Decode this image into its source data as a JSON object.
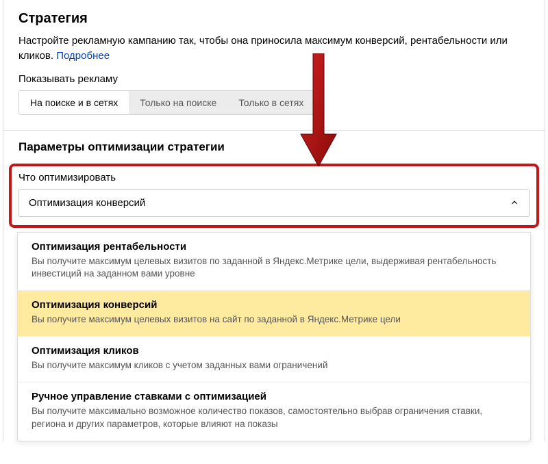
{
  "strategy": {
    "title": "Стратегия",
    "description": "Настройте рекламную кампанию так, чтобы она приносила максимум конверсий, рентабельности или кликов. ",
    "more_link": "Подробнее"
  },
  "show_ads": {
    "label": "Показывать рекламу",
    "options": [
      "На поиске и в сетях",
      "Только на поиске",
      "Только в сетях"
    ],
    "selected_index": 0
  },
  "params": {
    "heading": "Параметры оптимизации стратегии",
    "optimize_label": "Что оптимизировать",
    "selected_value": "Оптимизация конверсий"
  },
  "options": [
    {
      "title": "Оптимизация рентабельности",
      "desc": "Вы получите максимум целевых визитов по заданной в Яндекс.Метрике цели, выдерживая рентабельность инвестиций на заданном вами уровне",
      "selected": false
    },
    {
      "title": "Оптимизация конверсий",
      "desc": "Вы получите максимум целевых визитов на сайт по заданной в Яндекс.Метрике цели",
      "selected": true
    },
    {
      "title": "Оптимизация кликов",
      "desc": "Вы получите максимум кликов с учетом заданных вами ограничений",
      "selected": false
    },
    {
      "title": "Ручное управление ставками с оптимизацией",
      "desc": "Вы получите максимально возможное количество показов, самостоятельно выбрав ограничения ставки, региона и других параметров, которые влияют на показы",
      "selected": false
    }
  ]
}
